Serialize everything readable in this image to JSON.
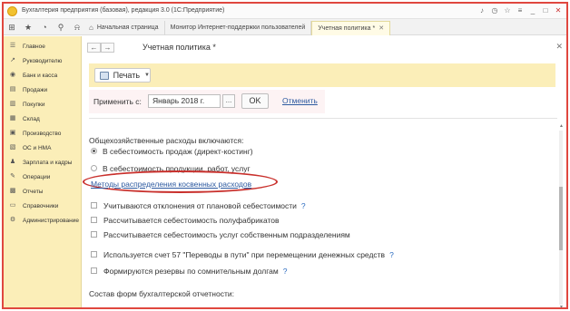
{
  "window": {
    "title": "Бухгалтерия предприятия (базовая), редакция 3.0 (1С:Предприятие)"
  },
  "tabs": [
    {
      "label": "Начальная страница"
    },
    {
      "label": "Монитор Интернет-поддержки пользователей"
    },
    {
      "label": "Учетная политика *"
    }
  ],
  "sidebar": {
    "items": [
      {
        "label": "Главное",
        "icon": "menu-icon"
      },
      {
        "label": "Руководителю",
        "icon": "chart-icon"
      },
      {
        "label": "Банк и касса",
        "icon": "bank-icon"
      },
      {
        "label": "Продажи",
        "icon": "cart-icon"
      },
      {
        "label": "Покупки",
        "icon": "basket-icon"
      },
      {
        "label": "Склад",
        "icon": "warehouse-icon"
      },
      {
        "label": "Производство",
        "icon": "factory-icon"
      },
      {
        "label": "ОС и НМА",
        "icon": "assets-icon"
      },
      {
        "label": "Зарплата и кадры",
        "icon": "people-icon"
      },
      {
        "label": "Операции",
        "icon": "operations-icon"
      },
      {
        "label": "Отчеты",
        "icon": "reports-icon"
      },
      {
        "label": "Справочники",
        "icon": "book-icon"
      },
      {
        "label": "Администрирование",
        "icon": "gear-icon"
      }
    ]
  },
  "document": {
    "title": "Учетная политика *",
    "print_label": "Печать",
    "apply_label": "Применить с:",
    "apply_value": "Январь 2018 г.",
    "apply_dots": "...",
    "ok_label": "OK",
    "cancel_label": "Отменить"
  },
  "form": {
    "overhead_label": "Общехозяйственные расходы включаются:",
    "radio_options": [
      {
        "label": "В себестоимость продаж (директ-костинг)",
        "checked": true
      },
      {
        "label": "В  себестоимость продукции, работ, услуг",
        "checked": false
      }
    ],
    "methods_link": "Методы распределения косвенных расходов",
    "checkboxes_group1": [
      {
        "label": "Учитываются отклонения от плановой себестоимости",
        "help": "?"
      },
      {
        "label": "Рассчитывается себестоимость полуфабрикатов",
        "help": ""
      },
      {
        "label": "Рассчитывается себестоимость услуг собственным подразделениям",
        "help": ""
      }
    ],
    "checkboxes_group2": [
      {
        "label": "Используется счет 57 \"Переводы в пути\" при перемещении денежных средств",
        "help": "?"
      },
      {
        "label": "Формируются резервы по сомнительным долгам",
        "help": "?"
      }
    ],
    "reports_label": "Состав форм бухгалтерской отчетности:"
  },
  "colors": {
    "frame_border": "#e0473f",
    "sidebar_bg": "#fbeeb8",
    "link": "#2d5aa0",
    "highlight": "#c9302c"
  }
}
